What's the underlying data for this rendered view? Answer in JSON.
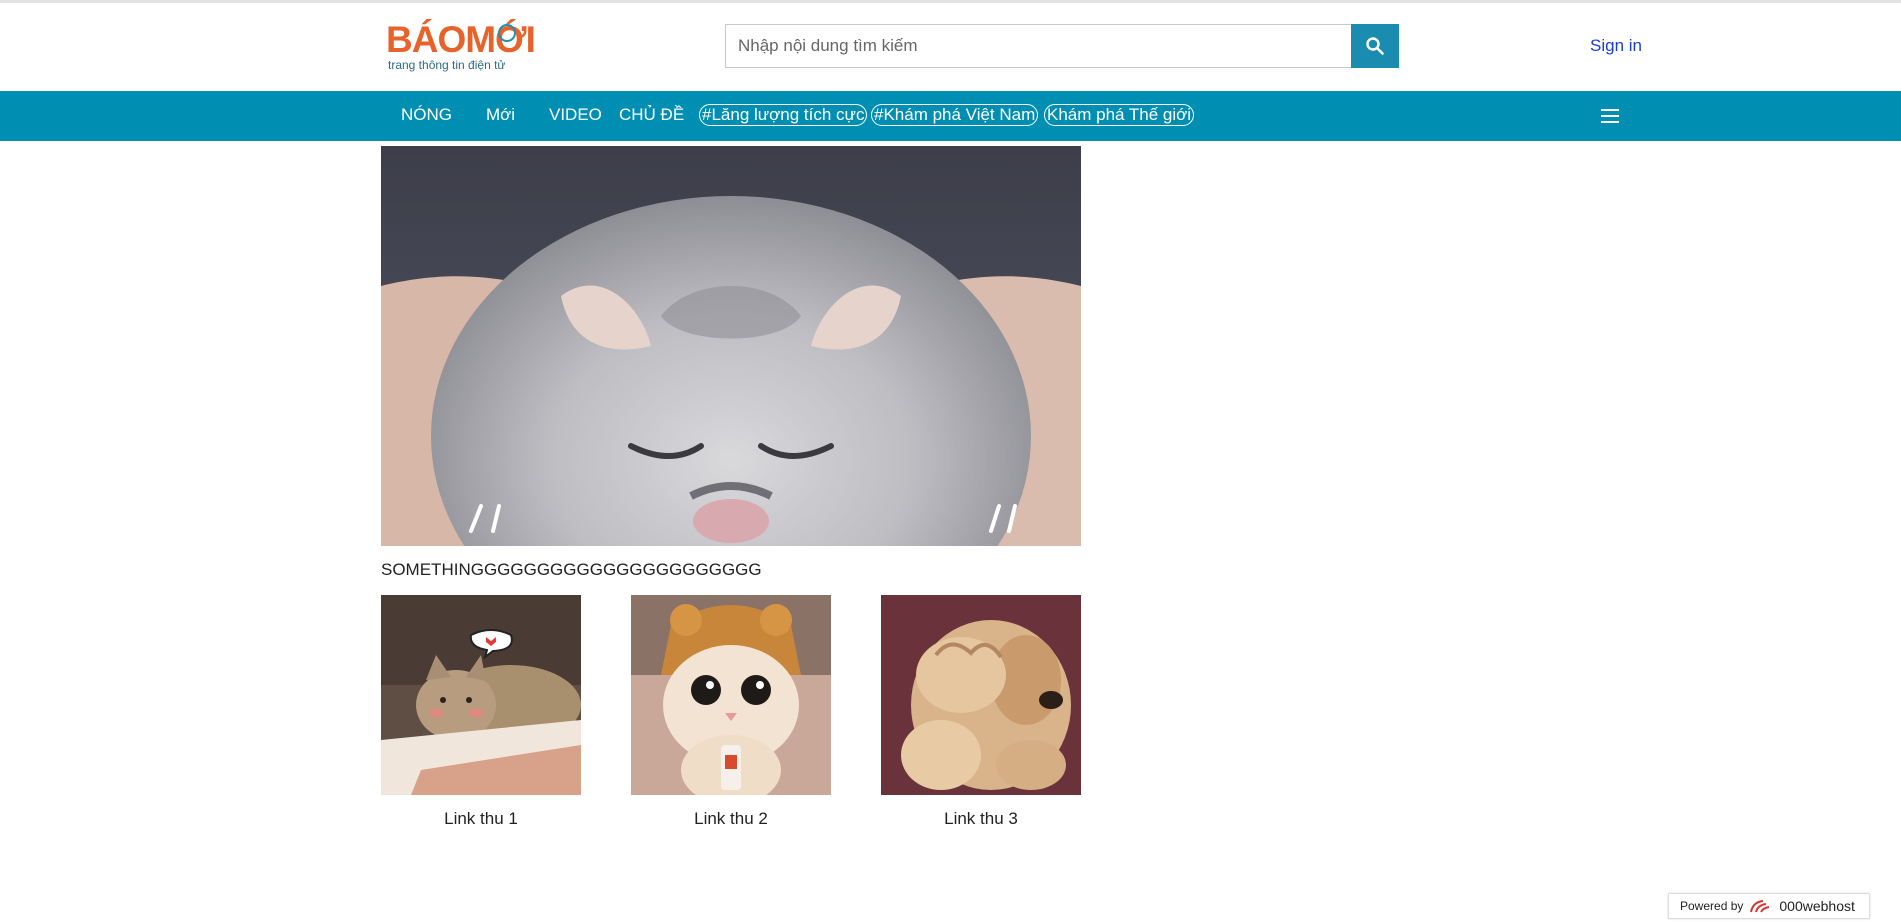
{
  "header": {
    "logo_text_1": "BÁO",
    "logo_text_2": "MỚI",
    "logo_tagline": "trang thông tin điện tử",
    "search_placeholder": "Nhập nội dung tìm kiếm",
    "search_value": "",
    "signin_label": "Sign in"
  },
  "nav": {
    "items": [
      {
        "label": "NÓNG"
      },
      {
        "label": "Mới"
      },
      {
        "label": "VIDEO"
      },
      {
        "label": "CHỦ ĐỀ"
      }
    ],
    "pills": [
      {
        "label": "#Lăng lượng tích cực"
      },
      {
        "label": "#Khám phá Việt Nam"
      },
      {
        "label": "Khám phá Thế giới"
      }
    ]
  },
  "main": {
    "caption": "SOMETHINGGGGGGGGGGGGGGGGGGGGGG",
    "thumbs": [
      {
        "label": "Link thu 1"
      },
      {
        "label": "Link thu 2"
      },
      {
        "label": "Link thu 3"
      }
    ]
  },
  "footer": {
    "powered_by": "Powered by",
    "brand": "000webhost"
  },
  "colors": {
    "nav_bg": "#008fb3",
    "search_button_bg": "#1a8caf",
    "logo_orange": "#e8632b",
    "signin_link": "#1a3fd0"
  }
}
